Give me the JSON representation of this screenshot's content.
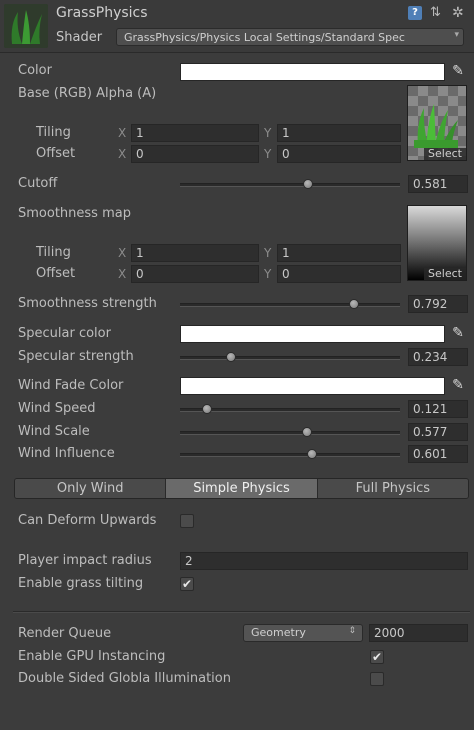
{
  "header": {
    "title": "GrassPhysics",
    "shader_label": "Shader",
    "shader_value": "GrassPhysics/Physics Local Settings/Standard Spec",
    "icons": [
      "help-icon",
      "preset-icon",
      "gear-icon"
    ]
  },
  "color": {
    "label": "Color",
    "value": "#FFFFFF"
  },
  "base_map": {
    "label": "Base (RGB) Alpha (A)",
    "tiling_label": "Tiling",
    "tiling_x": "1",
    "tiling_y": "1",
    "offset_label": "Offset",
    "offset_x": "0",
    "offset_y": "0",
    "select_label": "Select"
  },
  "axis": {
    "x": "X",
    "y": "Y"
  },
  "cutoff": {
    "label": "Cutoff",
    "value": "0.581",
    "fraction": 0.581
  },
  "smoothness_map": {
    "label": "Smoothness map",
    "tiling_label": "Tiling",
    "tiling_x": "1",
    "tiling_y": "1",
    "offset_label": "Offset",
    "offset_x": "0",
    "offset_y": "0",
    "select_label": "Select"
  },
  "smoothness_strength": {
    "label": "Smoothness strength",
    "value": "0.792",
    "fraction": 0.792
  },
  "specular_color": {
    "label": "Specular color",
    "value": "#FFFFFF"
  },
  "specular_strength": {
    "label": "Specular strength",
    "value": "0.234",
    "fraction": 0.234
  },
  "wind_fade_color": {
    "label": "Wind Fade Color",
    "value": "#FFFFFF"
  },
  "wind_speed": {
    "label": "Wind Speed",
    "value": "0.121",
    "fraction": 0.121
  },
  "wind_scale": {
    "label": "Wind Scale",
    "value": "0.577",
    "fraction": 0.577
  },
  "wind_influence": {
    "label": "Wind Influence",
    "value": "0.601",
    "fraction": 0.601
  },
  "tabs": [
    {
      "label": "Only Wind",
      "active": false
    },
    {
      "label": "Simple Physics",
      "active": true
    },
    {
      "label": "Full Physics",
      "active": false
    }
  ],
  "can_deform_upwards": {
    "label": "Can Deform Upwards",
    "checked": false
  },
  "player_impact_radius": {
    "label": "Player impact radius",
    "value": "2"
  },
  "enable_grass_tilting": {
    "label": "Enable grass tilting",
    "checked": true
  },
  "render_queue": {
    "label": "Render Queue",
    "dropdown": "Geometry",
    "value": "2000"
  },
  "gpu_instancing": {
    "label": "Enable GPU Instancing",
    "checked": true
  },
  "double_sided_gi": {
    "label": "Double Sided Globla Illumination",
    "checked": false
  }
}
